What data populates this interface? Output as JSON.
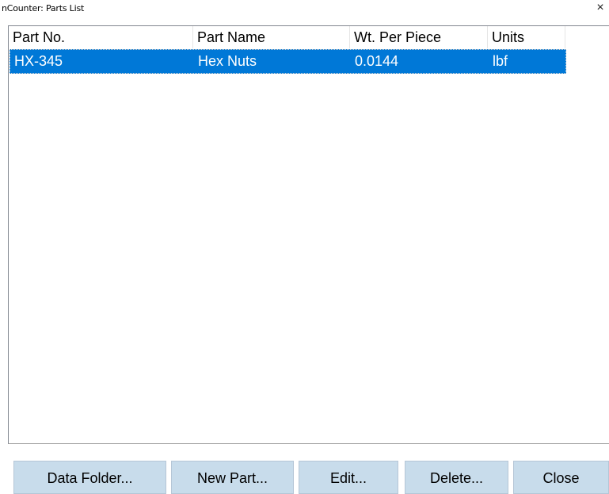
{
  "window": {
    "title": "nCounter: Parts List",
    "close_glyph": "×"
  },
  "list": {
    "columns": [
      "Part No.",
      "Part Name",
      "Wt. Per Piece",
      "Units"
    ],
    "rows": [
      {
        "part_no": "HX-345",
        "part_name": "Hex Nuts",
        "wt_per_piece": "0.0144",
        "units": "lbf",
        "selected": true
      }
    ]
  },
  "buttons": {
    "data_folder": "Data Folder...",
    "new_part": "New Part...",
    "edit": "Edit...",
    "delete": "Delete...",
    "close": "Close"
  },
  "colors": {
    "selection": "#0078d7",
    "button_face": "#c8dceb"
  }
}
